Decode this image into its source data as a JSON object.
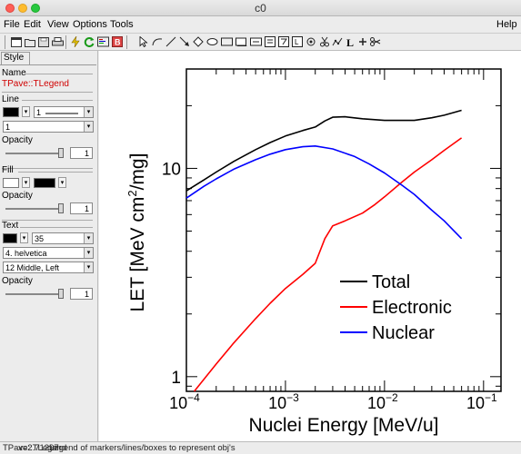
{
  "window": {
    "title": "c0"
  },
  "menu": {
    "file": "File",
    "edit": "Edit",
    "view": "View",
    "options": "Options",
    "tools": "Tools",
    "help": "Help"
  },
  "editor": {
    "tab": "Style",
    "name_label": "Name",
    "object_name": "TPave::TLegend",
    "line": {
      "section": "Line",
      "width": "1",
      "style_value": "1",
      "opacity_label": "Opacity",
      "opacity_value": "1",
      "color": "#000000"
    },
    "fill": {
      "section": "Fill",
      "opacity_label": "Opacity",
      "opacity_value": "1",
      "color": "#ffffff",
      "pattern_color": "#000000"
    },
    "text": {
      "section": "Text",
      "size": "35",
      "font": "4. helvetica",
      "align": "12 Middle, Left",
      "opacity_label": "Opacity",
      "opacity_value": "1",
      "color": "#000000"
    }
  },
  "plot": {
    "chart_data": {
      "type": "line",
      "xlabel": "Nuclei Energy [MeV/u]",
      "ylabel_parts": {
        "pre": "LET [MeV cm",
        "sup": "2",
        "post": "/mg]"
      },
      "x_scale": "log",
      "y_scale": "log",
      "xlim": [
        0.0001,
        0.15
      ],
      "ylim": [
        0.85,
        30
      ],
      "x_ticks": [
        {
          "value": 0.0001,
          "base": "10",
          "exp": "−4"
        },
        {
          "value": 0.001,
          "base": "10",
          "exp": "−3"
        },
        {
          "value": 0.01,
          "base": "10",
          "exp": "−2"
        },
        {
          "value": 0.1,
          "base": "10",
          "exp": "−1"
        }
      ],
      "y_ticks": [
        {
          "value": 1,
          "label": "1"
        },
        {
          "value": 10,
          "label": "10"
        }
      ],
      "legend_position": "middle-right",
      "series": [
        {
          "name": "Total",
          "color": "#000000",
          "x": [
            0.0001,
            0.00015,
            0.0002,
            0.0003,
            0.0005,
            0.0007,
            0.001,
            0.0015,
            0.002,
            0.0025,
            0.003,
            0.004,
            0.006,
            0.01,
            0.015,
            0.02,
            0.03,
            0.04,
            0.06
          ],
          "y": [
            7.8,
            8.8,
            9.6,
            10.8,
            12.3,
            13.3,
            14.3,
            15.2,
            15.8,
            16.9,
            17.6,
            17.7,
            17.3,
            17.0,
            17.0,
            17.0,
            17.5,
            18.0,
            19.0
          ]
        },
        {
          "name": "Electronic",
          "color": "#ff0000",
          "x": [
            0.00012,
            0.0002,
            0.0003,
            0.0005,
            0.0007,
            0.001,
            0.0015,
            0.002,
            0.0025,
            0.003,
            0.004,
            0.006,
            0.008,
            0.01,
            0.015,
            0.02,
            0.03,
            0.04,
            0.06
          ],
          "y": [
            0.85,
            1.15,
            1.45,
            1.9,
            2.25,
            2.65,
            3.1,
            3.5,
            4.6,
            5.3,
            5.6,
            6.1,
            6.7,
            7.3,
            8.6,
            9.6,
            11.0,
            12.2,
            14.0
          ]
        },
        {
          "name": "Nuclear",
          "color": "#0000ff",
          "x": [
            0.0001,
            0.00015,
            0.0002,
            0.0003,
            0.0005,
            0.0007,
            0.001,
            0.0015,
            0.002,
            0.003,
            0.005,
            0.007,
            0.01,
            0.015,
            0.02,
            0.03,
            0.04,
            0.06
          ],
          "y": [
            7.2,
            8.2,
            8.9,
            9.9,
            11.0,
            11.7,
            12.3,
            12.7,
            12.8,
            12.4,
            11.4,
            10.5,
            9.5,
            8.3,
            7.5,
            6.3,
            5.6,
            4.6
          ]
        }
      ]
    }
  },
  "status": {
    "left": "TPave::TLegend",
    "middle": "Legend of markers/lines/boxes to represent obj's",
    "right": "x=2.71297"
  }
}
